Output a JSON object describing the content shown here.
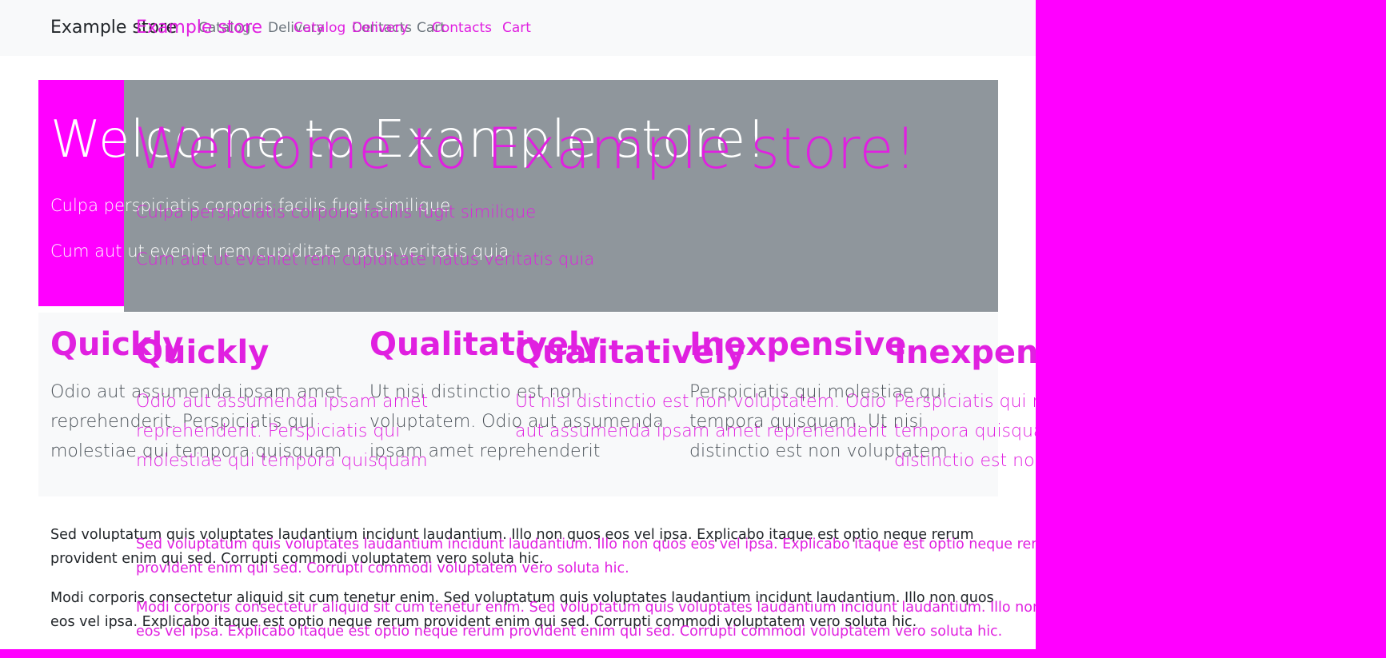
{
  "navbar": {
    "brand": "Example store",
    "links": [
      "Catalog",
      "Delivery",
      "Contacts",
      "Cart"
    ]
  },
  "hero": {
    "title": "Welcome to Example store!",
    "lead1": "Culpa perspiciatis corporis facilis fugit similique",
    "lead2": "Cum aut ut eveniet rem cupiditate natus veritatis quia"
  },
  "features": [
    {
      "title": "Quickly",
      "text": "Odio aut assumenda ipsam amet reprehenderit. Perspiciatis qui molestiae qui tempora quisquam"
    },
    {
      "title": "Qualitatively",
      "text": "Ut nisi distinctio est non voluptatem. Odio aut assumenda ipsam amet reprehenderit"
    },
    {
      "title": "Inexpensive",
      "text": "Perspiciatis qui molestiae qui tempora quisquam. Ut nisi distinctio est non voluptatem"
    }
  ],
  "paragraphs": [
    "Sed voluptatum quis voluptates laudantium incidunt laudantium. Illo non quos eos vel ipsa. Explicabo itaque est optio neque rerum provident enim qui sed. Corrupti commodi voluptatem vero soluta hic.",
    "Modi corporis consectetur aliquid sit cum tenetur enim. Sed voluptatum quis voluptates laudantium incidunt laudantium. Illo non quos eos vel ipsa. Explicabo itaque est optio neque rerum provident enim qui sed. Corrupti commodi voluptatem vero soluta hic."
  ],
  "colors": {
    "background_overflow": "#ff00ff",
    "ghost_text": "#e020e0",
    "hero_gray": "#8f969c",
    "navbar_bg": "#f8f9fa"
  }
}
